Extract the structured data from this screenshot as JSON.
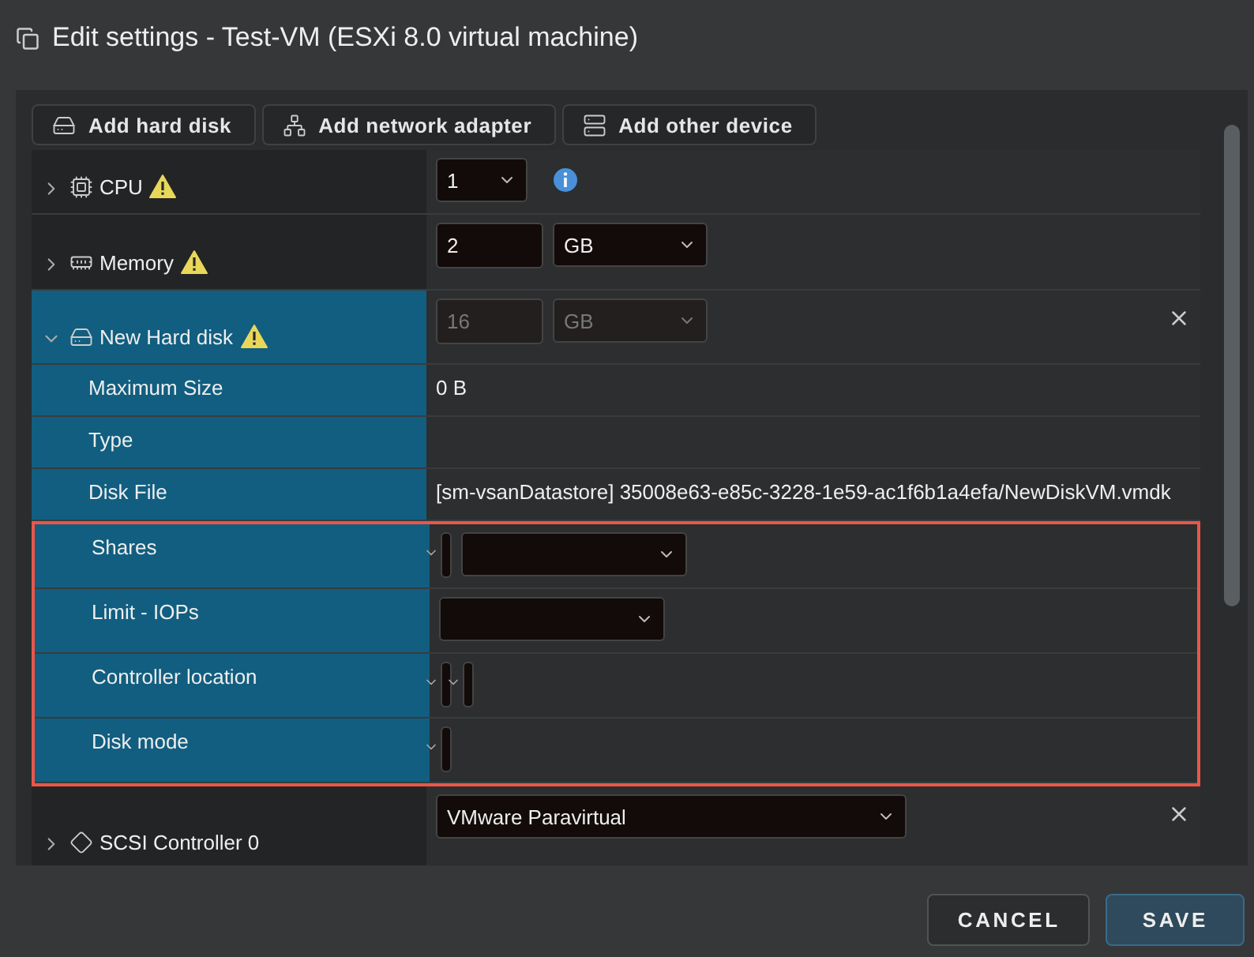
{
  "window": {
    "title": "Edit settings - Test-VM (ESXi 8.0 virtual machine)"
  },
  "toolbar": [
    {
      "kind": "hard-disk",
      "label": "Add hard disk"
    },
    {
      "kind": "network",
      "label": "Add network adapter"
    },
    {
      "kind": "device",
      "label": "Add other device"
    }
  ],
  "devices": [
    {
      "kind": "cpu",
      "label": "CPU",
      "expanded": false,
      "selected": false,
      "warning": true,
      "info": true,
      "removable": false,
      "controls": [
        {
          "kind": "count-select",
          "value": "1",
          "disabled": false
        }
      ]
    },
    {
      "kind": "memory",
      "label": "Memory",
      "expanded": false,
      "selected": false,
      "warning": true,
      "info": false,
      "removable": false,
      "controls": [
        {
          "kind": "input",
          "value": "2",
          "disabled": false
        },
        {
          "kind": "unit-select",
          "value": "GB",
          "disabled": false
        }
      ]
    },
    {
      "kind": "hard-disk",
      "label": "New Hard disk",
      "expanded": true,
      "selected": true,
      "warning": true,
      "info": false,
      "removable": true,
      "controls": [
        {
          "kind": "input",
          "value": "16",
          "disabled": true
        },
        {
          "kind": "unit-select",
          "value": "GB",
          "disabled": true
        }
      ],
      "children": [
        {
          "label": "Maximum Size",
          "value": "0 B",
          "flagged": false
        },
        {
          "label": "Type",
          "flagged": false
        },
        {
          "label": "Disk File",
          "value": "[sm-vsanDatastore] 35008e63-e85c-3228-1e59-ac1f6b1a4efa/NewDiskVM.vmdk",
          "flagged": false
        },
        {
          "label": "Shares",
          "flagged": true,
          "controls": [
            {
              "kind": "collapsed-select",
              "disabled": false
            },
            {
              "kind": "level-select",
              "disabled": false
            }
          ]
        },
        {
          "label": "Limit - IOPs",
          "flagged": true,
          "controls": [
            {
              "kind": "level-select",
              "disabled": false
            }
          ]
        },
        {
          "label": "Controller location",
          "flagged": true,
          "controls": [
            {
              "kind": "collapsed-select",
              "disabled": false
            },
            {
              "kind": "collapsed-select",
              "disabled": false
            }
          ]
        },
        {
          "label": "Disk mode",
          "flagged": true,
          "controls": [
            {
              "kind": "collapsed-select",
              "disabled": false
            }
          ]
        }
      ]
    },
    {
      "kind": "scsi-controller",
      "label": "SCSI Controller 0",
      "expanded": false,
      "selected": false,
      "warning": false,
      "info": false,
      "removable": true,
      "controls": [
        {
          "kind": "type-select",
          "value": "VMware Paravirtual",
          "disabled": false
        }
      ]
    }
  ],
  "buttons": [
    {
      "kind": "secondary",
      "label": "CANCEL"
    },
    {
      "kind": "primary",
      "label": "SAVE"
    }
  ]
}
